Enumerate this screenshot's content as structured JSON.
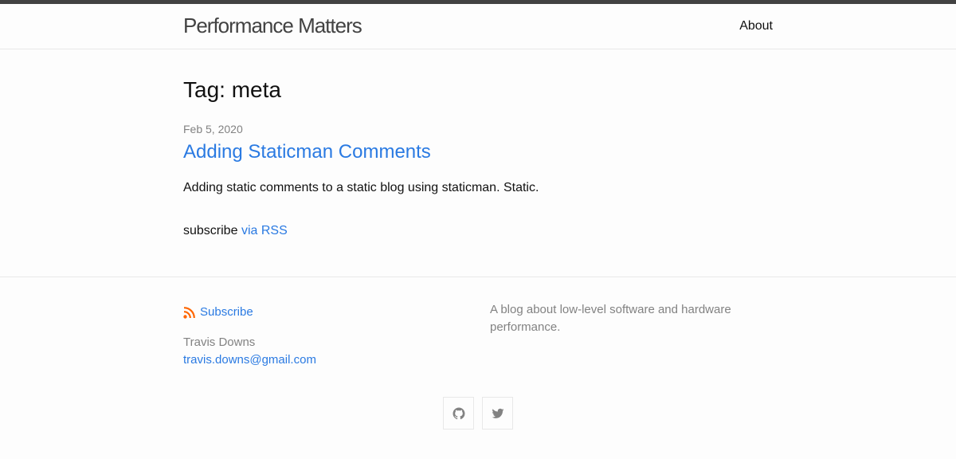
{
  "header": {
    "site_title": "Performance Matters",
    "nav": [
      {
        "label": "About"
      }
    ]
  },
  "main": {
    "heading": "Tag: meta",
    "posts": [
      {
        "date": "Feb 5, 2020",
        "title": "Adding Staticman Comments",
        "excerpt": "Adding static comments to a static blog using staticman. Static."
      }
    ],
    "subscribe_prefix": "subscribe",
    "subscribe_link": "via RSS"
  },
  "footer": {
    "subscribe_label": "Subscribe",
    "author_name": "Travis Downs",
    "author_email": "travis.downs@gmail.com",
    "description": "A blog about low-level software and hardware performance.",
    "social": [
      {
        "icon": "github-icon"
      },
      {
        "icon": "twitter-icon"
      }
    ]
  },
  "colors": {
    "link": "#2a7ae2",
    "rss": "#ff6600",
    "muted": "#828282",
    "topbar": "#424242"
  }
}
